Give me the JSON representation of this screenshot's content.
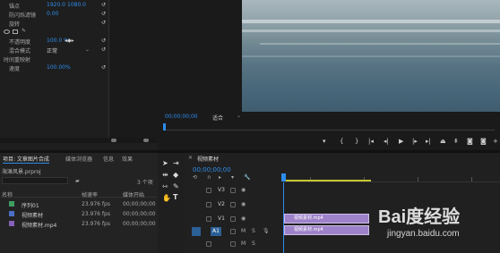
{
  "effect_controls": {
    "rows": [
      {
        "label": "锚点",
        "v1": "1920.0",
        "v2": "1080.0"
      },
      {
        "label": "防闪烁滤镜",
        "v1": "0.00",
        "v2": ""
      },
      {
        "label": "旋转",
        "v1": "",
        "v2": ""
      },
      {
        "label": "不透明度",
        "v1": "100.0 %",
        "v2": ""
      },
      {
        "label": "混合模式",
        "v1": "正常",
        "v2": ""
      },
      {
        "label": "时间重映射",
        "v1": "",
        "v2": ""
      },
      {
        "label": "速度",
        "v1": "100.00%",
        "v2": ""
      }
    ]
  },
  "program_monitor": {
    "timecode": "00;00;00;00",
    "fit_label": "适合",
    "fit_options": [
      "适合"
    ]
  },
  "project_panel": {
    "tabs": [
      "项目: 文章图片合成",
      "媒体浏览器",
      "信息",
      "效果"
    ],
    "project_file": "海滩风景.prproj",
    "item_count": "3 个项",
    "columns": [
      "名称",
      "帧速率",
      "媒体开始"
    ],
    "items": [
      {
        "name": "序列01",
        "fps": "23.976 fps",
        "start": "00;00;00;00",
        "color": "#3f9d62",
        "icon": "sequence-icon"
      },
      {
        "name": "视频素材",
        "fps": "23.976 fps",
        "start": "00;00;00;00",
        "color": "#4a6fc4",
        "icon": "video-icon"
      },
      {
        "name": "视频素材.mp4",
        "fps": "23.976 fps",
        "start": "00;00;00;00",
        "color": "#8560b8",
        "icon": "media-icon"
      }
    ]
  },
  "timeline": {
    "tab": "视频素材",
    "timecode": "00;00;00;00",
    "tracks": [
      "V3",
      "V2",
      "V1",
      "A1"
    ],
    "clips": [
      {
        "name": "视频素材.mp4",
        "track": "V1"
      },
      {
        "name": "视频素材.mp4",
        "track": "A1"
      }
    ]
  },
  "watermark": {
    "brand": "Bai度经验",
    "url": "jingyan.baidu.com"
  },
  "colors": {
    "accent": "#2d8ceb",
    "clip": "#9e82c9",
    "work_area": "#c7c732",
    "panel": "#232323"
  }
}
